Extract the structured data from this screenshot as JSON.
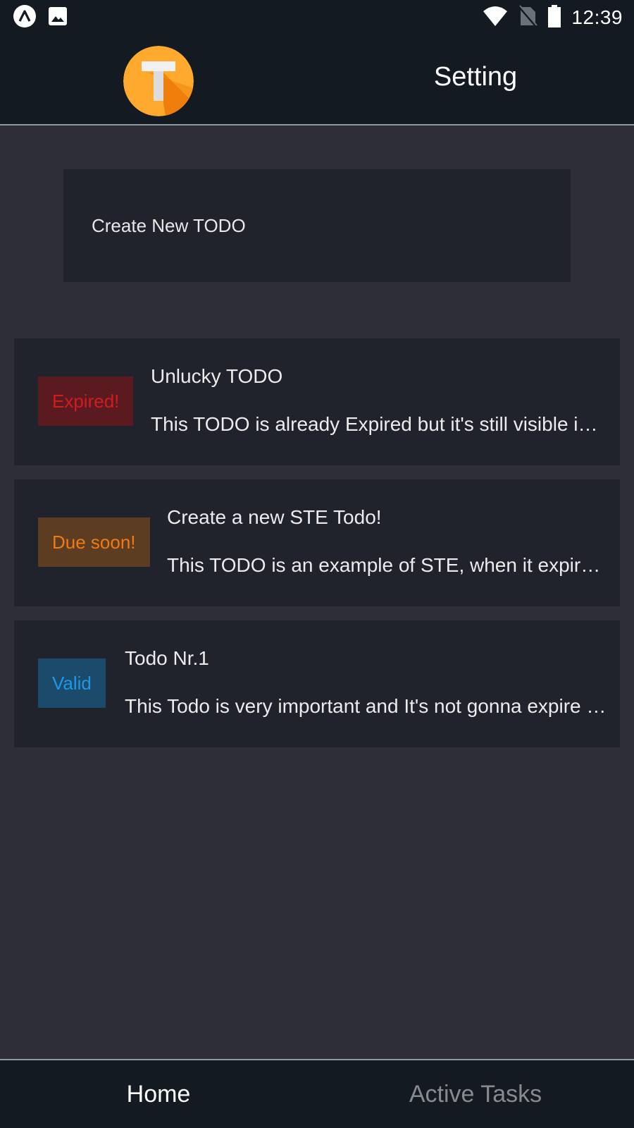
{
  "status_bar": {
    "time": "12:39",
    "left_icons": [
      "expo-icon",
      "image-icon"
    ],
    "right_icons": [
      "wifi-icon",
      "no-sim-icon",
      "battery-icon"
    ]
  },
  "header": {
    "logo_letter": "T",
    "title": "Setting"
  },
  "create_button": {
    "label": "Create New TODO"
  },
  "todos": [
    {
      "badge": "Expired!",
      "badge_bg": "#5a1a20",
      "badge_color": "#d31c1c",
      "title": "Unlucky TODO",
      "description": "This TODO is already Expired but it's still visible in the list"
    },
    {
      "badge": "Due soon!",
      "badge_bg": "#5c3d22",
      "badge_color": "#f07a14",
      "title": "Create a new STE Todo!",
      "description": "This TODO is an example of STE, when it expires it will be shown"
    },
    {
      "badge": "Valid",
      "badge_bg": "#1b4a6b",
      "badge_color": "#1e98e6",
      "title": "Todo Nr.1",
      "description": "This Todo is very important and It's not gonna expire soon at all"
    }
  ],
  "bottom_nav": {
    "tabs": [
      {
        "label": "Home",
        "active": true
      },
      {
        "label": "Active Tasks",
        "active": false
      }
    ]
  },
  "colors": {
    "background": "#2d2e38",
    "bar": "#131a22",
    "card": "#20222c",
    "logo_orange": "#ff9a1c",
    "active_tab": "#ffffff",
    "inactive_tab": "#8a8a8e"
  }
}
